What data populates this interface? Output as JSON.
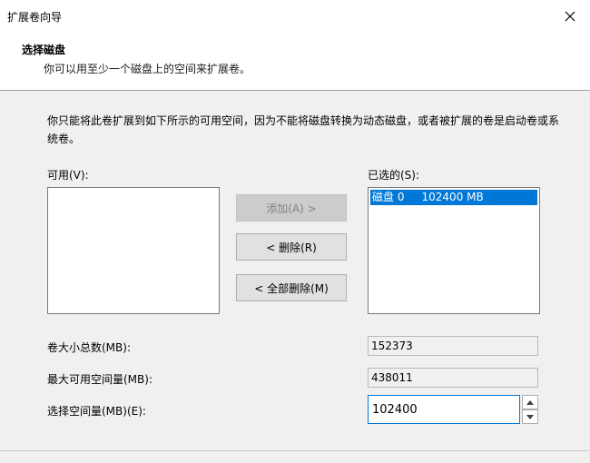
{
  "window": {
    "title": "扩展卷向导"
  },
  "header": {
    "title": "选择磁盘",
    "subtitle": "你可以用至少一个磁盘上的空间来扩展卷。"
  },
  "description": "你只能将此卷扩展到如下所示的可用空间，因为不能将磁盘转换为动态磁盘，或者被扩展的卷是启动卷或系统卷。",
  "available": {
    "label": "可用(V):",
    "items": []
  },
  "selected": {
    "label": "已选的(S):",
    "items": [
      {
        "text": "磁盘 0     102400 MB",
        "selected": true
      }
    ]
  },
  "buttons": {
    "add": "添加(A) >",
    "remove": "< 删除(R)",
    "remove_all": "< 全部删除(M)"
  },
  "fields": {
    "total_label": "卷大小总数(MB):",
    "total_value": "152373",
    "max_label": "最大可用空间量(MB):",
    "max_value": "438011",
    "select_label": "选择空间量(MB)(E):",
    "select_value": "102400"
  },
  "icons": {
    "close": "close-icon",
    "spin_up": "spin-up-icon",
    "spin_down": "spin-down-icon"
  }
}
